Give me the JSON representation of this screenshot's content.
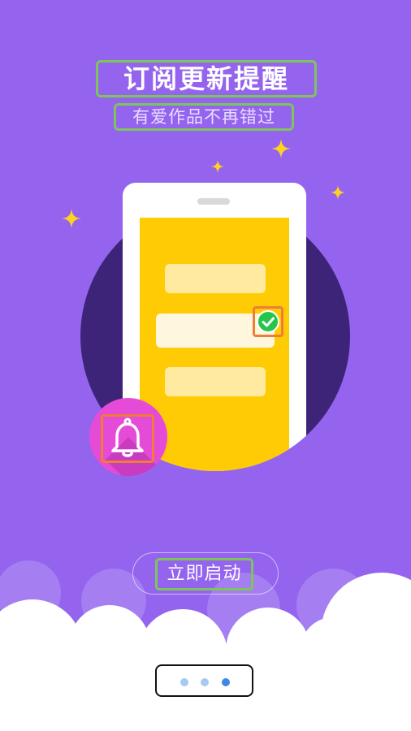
{
  "onboarding": {
    "headline": "订阅更新提醒",
    "subheadline": "有爱作品不再错过",
    "start_button_label": "立即启动",
    "page_indicator": {
      "total_pages": 3,
      "active_page": 3
    }
  },
  "colors": {
    "background": "#9464ef",
    "phone_screen": "#ffcb05",
    "bell_badge": "#e64bd8",
    "check_badge": "#23c64a",
    "sparkle": "#ffd21f",
    "active_dot": "#3f86e6",
    "inactive_dot": "#a8c9f2"
  },
  "icons": {
    "check": "check-circle-icon",
    "bell": "bell-icon",
    "sparkle": "sparkle-icon"
  }
}
